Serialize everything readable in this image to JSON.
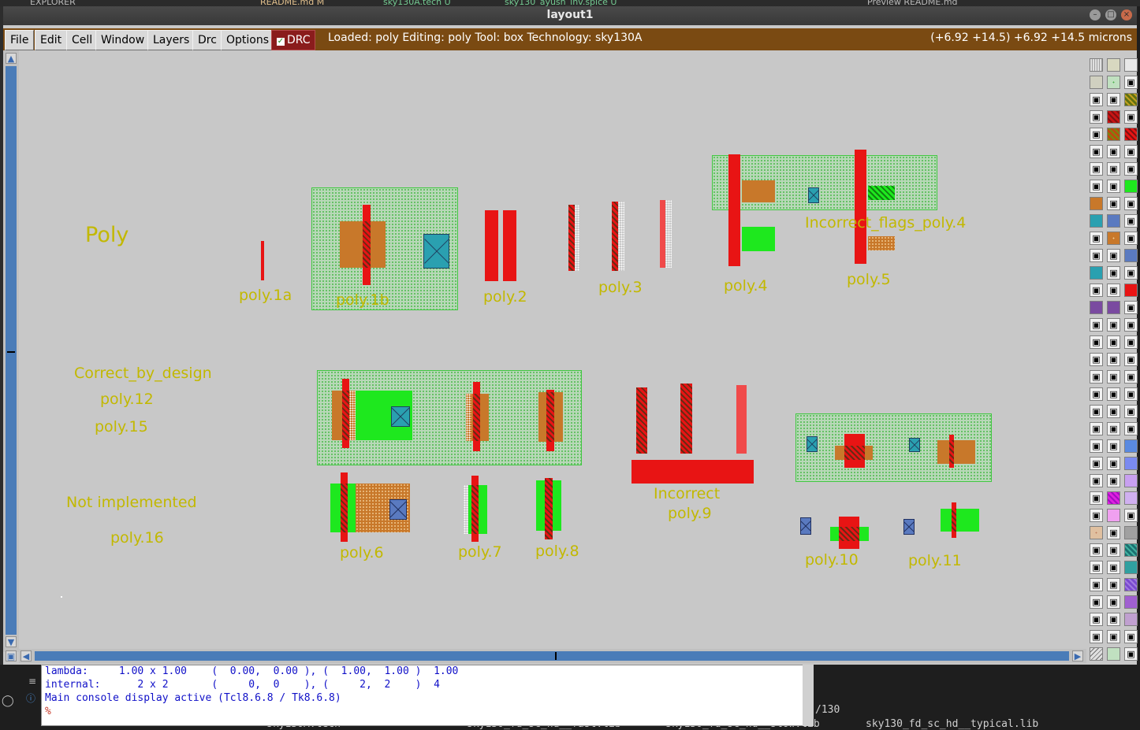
{
  "host": {
    "tabs": [
      "EXPLORER",
      "README.md M",
      "sky130A.tech U",
      "sky130_ayush_inv.spice U",
      "Preview README.md"
    ],
    "terminal_bottom": [
      "sky130A.tech",
      "sky130_fd_sc_hd__fast.lib",
      "sky130_fd_sc_hd__slow.lib",
      "sky130_fd_sc_hd__typical.lib"
    ],
    "terminal_side": "/130"
  },
  "window": {
    "title": "layout1",
    "buttons": [
      "minimize",
      "maximize",
      "close"
    ]
  },
  "menubar": {
    "items": [
      "File",
      "Edit",
      "Cell",
      "Window",
      "Layers",
      "Drc",
      "Options"
    ],
    "drc_toggle": "DRC",
    "status": "Loaded: poly Editing: poly Tool: box  Technology: sky130A",
    "coords": "(+6.92 +14.5) +6.92 +14.5 microns"
  },
  "colors": {
    "menubar_bg": "#7a4a12",
    "poly": "#e81414",
    "diff": "#1ee81e",
    "label": "#c2b800",
    "scroll": "#4a7cb8"
  },
  "canvas": {
    "labels": {
      "poly_title": "Poly",
      "poly_1a": "poly.1a",
      "poly_1b": "poly.1b",
      "poly_2": "poly.2",
      "poly_3": "poly.3",
      "poly_4": "poly.4",
      "poly_5": "poly.5",
      "incorrect_flags": "Incorrect_flags_poly.4",
      "correct_by_design": "Correct_by_design",
      "poly_12": "poly.12",
      "poly_15": "poly.15",
      "not_implemented": "Not implemented",
      "poly_16": "poly.16",
      "poly_6": "poly.6",
      "poly_7": "poly.7",
      "poly_8": "poly.8",
      "incorrect": "Incorrect",
      "poly_9": "poly.9",
      "poly_10": "poly.10",
      "poly_11": "poly.11"
    }
  },
  "console": {
    "lines": [
      "lambda:     1.00 x 1.00    (  0.00,  0.00 ), (  1.00,  1.00 )  1.00",
      "internal:      2 x 2       (     0,  0    ), (     2,  2    )  4",
      "Main console display active (Tcl8.6.8 / Tk8.6.8)"
    ],
    "prompt": "%"
  }
}
